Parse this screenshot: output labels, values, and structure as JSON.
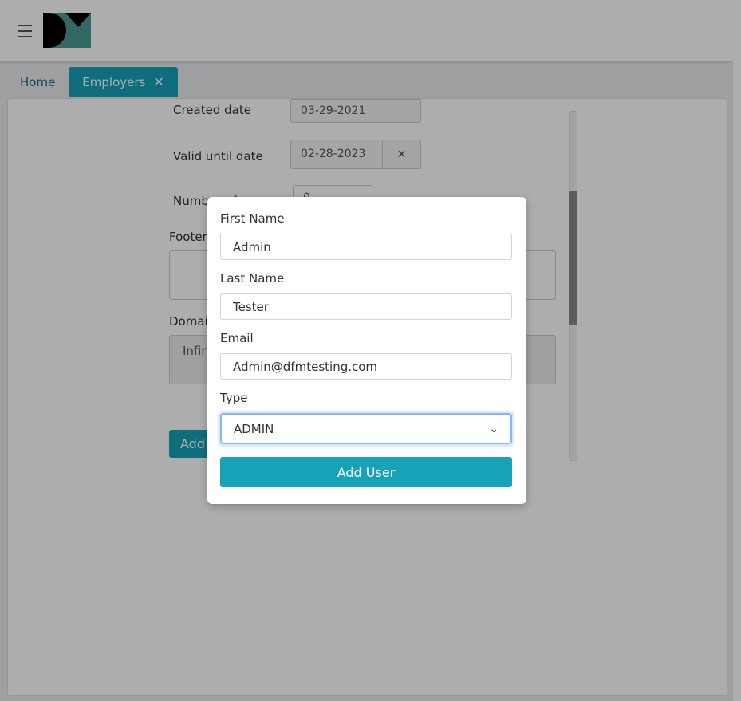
{
  "tabs": [
    {
      "label": "Home"
    },
    {
      "label": "Employers",
      "close_icon": "✕"
    }
  ],
  "background_form": {
    "created_date_label": "Created date",
    "created_date_value": "03-29-2021",
    "valid_until_label": "Valid until date",
    "valid_until_value": "02-28-2023",
    "clear_icon": "✕",
    "number_label": "Number of u",
    "number_value": "0",
    "footer_label": "Footer",
    "domain_label": "Domain",
    "domain_value": "Infin",
    "add_button_label": "Add"
  },
  "modal": {
    "first_name_label": "First Name",
    "first_name_value": "Admin",
    "last_name_label": "Last Name",
    "last_name_value": "Tester",
    "email_label": "Email",
    "email_value": "Admin@dfmtesting.com",
    "type_label": "Type",
    "type_value": "ADMIN",
    "submit_label": "Add User"
  },
  "colors": {
    "accent": "#17a2b8",
    "logo_teal": "#4a9b96",
    "logo_dark": "#000000"
  }
}
